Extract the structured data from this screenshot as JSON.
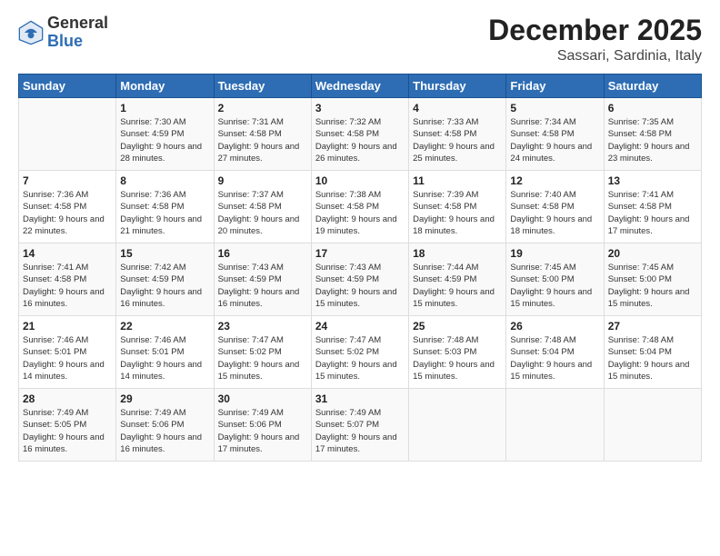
{
  "header": {
    "logo_general": "General",
    "logo_blue": "Blue",
    "month": "December 2025",
    "location": "Sassari, Sardinia, Italy"
  },
  "days_of_week": [
    "Sunday",
    "Monday",
    "Tuesday",
    "Wednesday",
    "Thursday",
    "Friday",
    "Saturday"
  ],
  "weeks": [
    [
      {
        "day": "",
        "sunrise": "",
        "sunset": "",
        "daylight": ""
      },
      {
        "day": "1",
        "sunrise": "Sunrise: 7:30 AM",
        "sunset": "Sunset: 4:59 PM",
        "daylight": "Daylight: 9 hours and 28 minutes."
      },
      {
        "day": "2",
        "sunrise": "Sunrise: 7:31 AM",
        "sunset": "Sunset: 4:58 PM",
        "daylight": "Daylight: 9 hours and 27 minutes."
      },
      {
        "day": "3",
        "sunrise": "Sunrise: 7:32 AM",
        "sunset": "Sunset: 4:58 PM",
        "daylight": "Daylight: 9 hours and 26 minutes."
      },
      {
        "day": "4",
        "sunrise": "Sunrise: 7:33 AM",
        "sunset": "Sunset: 4:58 PM",
        "daylight": "Daylight: 9 hours and 25 minutes."
      },
      {
        "day": "5",
        "sunrise": "Sunrise: 7:34 AM",
        "sunset": "Sunset: 4:58 PM",
        "daylight": "Daylight: 9 hours and 24 minutes."
      },
      {
        "day": "6",
        "sunrise": "Sunrise: 7:35 AM",
        "sunset": "Sunset: 4:58 PM",
        "daylight": "Daylight: 9 hours and 23 minutes."
      }
    ],
    [
      {
        "day": "7",
        "sunrise": "Sunrise: 7:36 AM",
        "sunset": "Sunset: 4:58 PM",
        "daylight": "Daylight: 9 hours and 22 minutes."
      },
      {
        "day": "8",
        "sunrise": "Sunrise: 7:36 AM",
        "sunset": "Sunset: 4:58 PM",
        "daylight": "Daylight: 9 hours and 21 minutes."
      },
      {
        "day": "9",
        "sunrise": "Sunrise: 7:37 AM",
        "sunset": "Sunset: 4:58 PM",
        "daylight": "Daylight: 9 hours and 20 minutes."
      },
      {
        "day": "10",
        "sunrise": "Sunrise: 7:38 AM",
        "sunset": "Sunset: 4:58 PM",
        "daylight": "Daylight: 9 hours and 19 minutes."
      },
      {
        "day": "11",
        "sunrise": "Sunrise: 7:39 AM",
        "sunset": "Sunset: 4:58 PM",
        "daylight": "Daylight: 9 hours and 18 minutes."
      },
      {
        "day": "12",
        "sunrise": "Sunrise: 7:40 AM",
        "sunset": "Sunset: 4:58 PM",
        "daylight": "Daylight: 9 hours and 18 minutes."
      },
      {
        "day": "13",
        "sunrise": "Sunrise: 7:41 AM",
        "sunset": "Sunset: 4:58 PM",
        "daylight": "Daylight: 9 hours and 17 minutes."
      }
    ],
    [
      {
        "day": "14",
        "sunrise": "Sunrise: 7:41 AM",
        "sunset": "Sunset: 4:58 PM",
        "daylight": "Daylight: 9 hours and 16 minutes."
      },
      {
        "day": "15",
        "sunrise": "Sunrise: 7:42 AM",
        "sunset": "Sunset: 4:59 PM",
        "daylight": "Daylight: 9 hours and 16 minutes."
      },
      {
        "day": "16",
        "sunrise": "Sunrise: 7:43 AM",
        "sunset": "Sunset: 4:59 PM",
        "daylight": "Daylight: 9 hours and 16 minutes."
      },
      {
        "day": "17",
        "sunrise": "Sunrise: 7:43 AM",
        "sunset": "Sunset: 4:59 PM",
        "daylight": "Daylight: 9 hours and 15 minutes."
      },
      {
        "day": "18",
        "sunrise": "Sunrise: 7:44 AM",
        "sunset": "Sunset: 4:59 PM",
        "daylight": "Daylight: 9 hours and 15 minutes."
      },
      {
        "day": "19",
        "sunrise": "Sunrise: 7:45 AM",
        "sunset": "Sunset: 5:00 PM",
        "daylight": "Daylight: 9 hours and 15 minutes."
      },
      {
        "day": "20",
        "sunrise": "Sunrise: 7:45 AM",
        "sunset": "Sunset: 5:00 PM",
        "daylight": "Daylight: 9 hours and 15 minutes."
      }
    ],
    [
      {
        "day": "21",
        "sunrise": "Sunrise: 7:46 AM",
        "sunset": "Sunset: 5:01 PM",
        "daylight": "Daylight: 9 hours and 14 minutes."
      },
      {
        "day": "22",
        "sunrise": "Sunrise: 7:46 AM",
        "sunset": "Sunset: 5:01 PM",
        "daylight": "Daylight: 9 hours and 14 minutes."
      },
      {
        "day": "23",
        "sunrise": "Sunrise: 7:47 AM",
        "sunset": "Sunset: 5:02 PM",
        "daylight": "Daylight: 9 hours and 15 minutes."
      },
      {
        "day": "24",
        "sunrise": "Sunrise: 7:47 AM",
        "sunset": "Sunset: 5:02 PM",
        "daylight": "Daylight: 9 hours and 15 minutes."
      },
      {
        "day": "25",
        "sunrise": "Sunrise: 7:48 AM",
        "sunset": "Sunset: 5:03 PM",
        "daylight": "Daylight: 9 hours and 15 minutes."
      },
      {
        "day": "26",
        "sunrise": "Sunrise: 7:48 AM",
        "sunset": "Sunset: 5:04 PM",
        "daylight": "Daylight: 9 hours and 15 minutes."
      },
      {
        "day": "27",
        "sunrise": "Sunrise: 7:48 AM",
        "sunset": "Sunset: 5:04 PM",
        "daylight": "Daylight: 9 hours and 15 minutes."
      }
    ],
    [
      {
        "day": "28",
        "sunrise": "Sunrise: 7:49 AM",
        "sunset": "Sunset: 5:05 PM",
        "daylight": "Daylight: 9 hours and 16 minutes."
      },
      {
        "day": "29",
        "sunrise": "Sunrise: 7:49 AM",
        "sunset": "Sunset: 5:06 PM",
        "daylight": "Daylight: 9 hours and 16 minutes."
      },
      {
        "day": "30",
        "sunrise": "Sunrise: 7:49 AM",
        "sunset": "Sunset: 5:06 PM",
        "daylight": "Daylight: 9 hours and 17 minutes."
      },
      {
        "day": "31",
        "sunrise": "Sunrise: 7:49 AM",
        "sunset": "Sunset: 5:07 PM",
        "daylight": "Daylight: 9 hours and 17 minutes."
      },
      {
        "day": "",
        "sunrise": "",
        "sunset": "",
        "daylight": ""
      },
      {
        "day": "",
        "sunrise": "",
        "sunset": "",
        "daylight": ""
      },
      {
        "day": "",
        "sunrise": "",
        "sunset": "",
        "daylight": ""
      }
    ]
  ]
}
